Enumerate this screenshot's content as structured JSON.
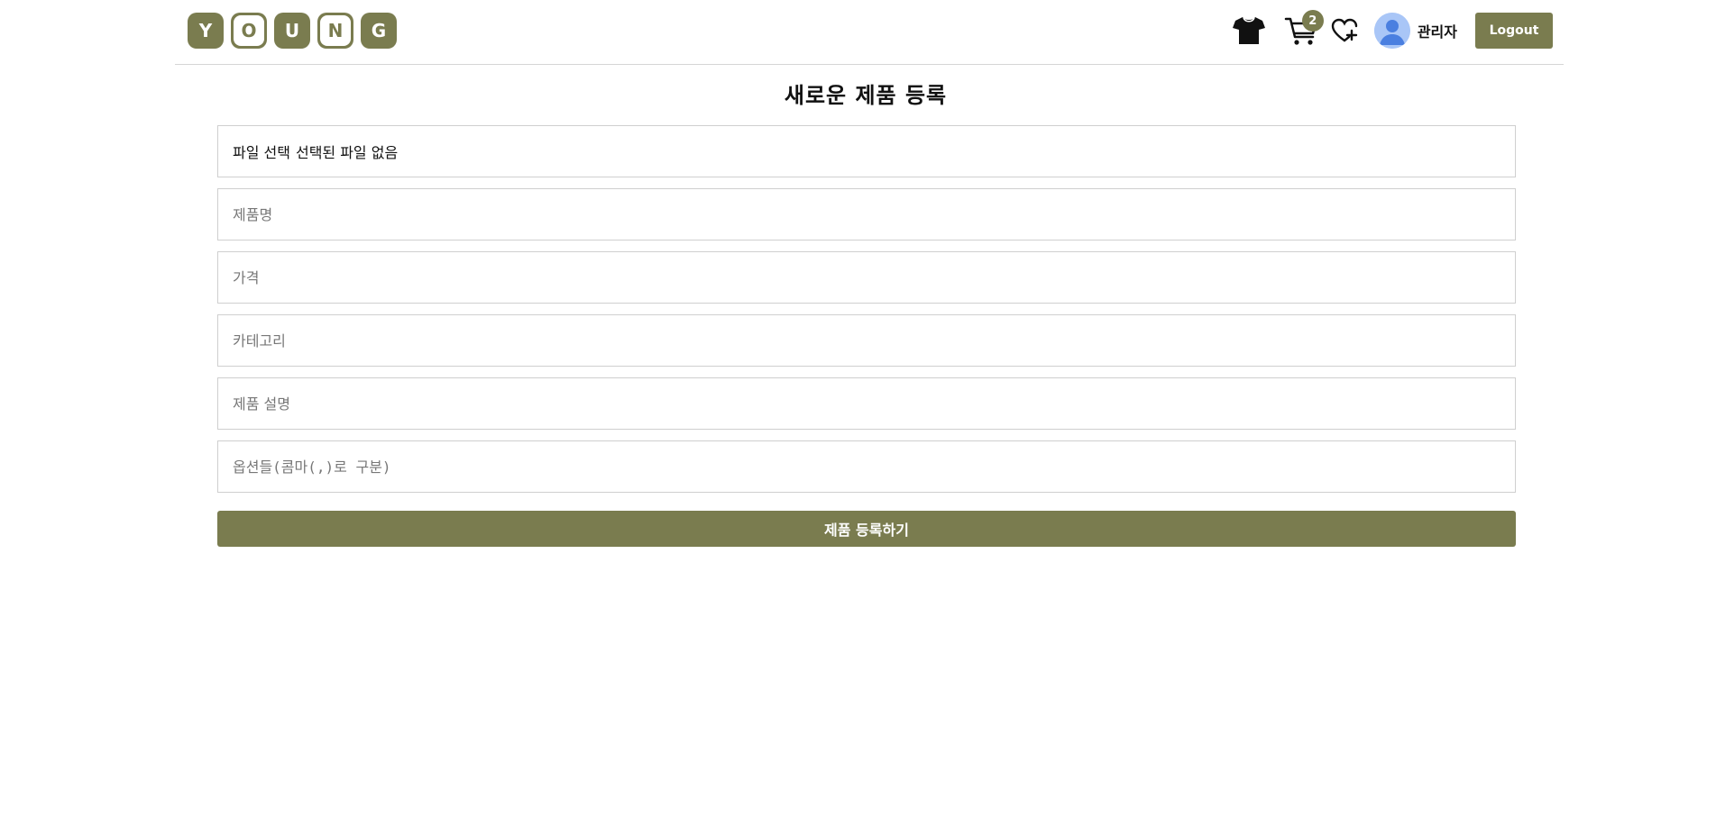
{
  "header": {
    "logo_letters": [
      "Y",
      "O",
      "U",
      "N",
      "G"
    ],
    "cart_count": "2",
    "user_name": "관리자",
    "logout_label": "Logout"
  },
  "page": {
    "title": "새로운 제품 등록"
  },
  "form": {
    "file_button_label": "파일 선택",
    "file_status": "선택된 파일 없음",
    "name_placeholder": "제품명",
    "price_placeholder": "가격",
    "category_placeholder": "카테고리",
    "description_placeholder": "제품 설명",
    "options_placeholder": "옵션들(콤마(,)로 구분)",
    "submit_label": "제품 등록하기"
  },
  "colors": {
    "brand": "#7a7c4f",
    "avatar_bg": "#a9c6f7",
    "avatar_fg": "#4a7fe0"
  },
  "icons": {
    "shirt": "shirt-icon",
    "cart": "cart-icon",
    "wishlist": "heart-plus-icon",
    "avatar": "user-avatar-icon"
  }
}
